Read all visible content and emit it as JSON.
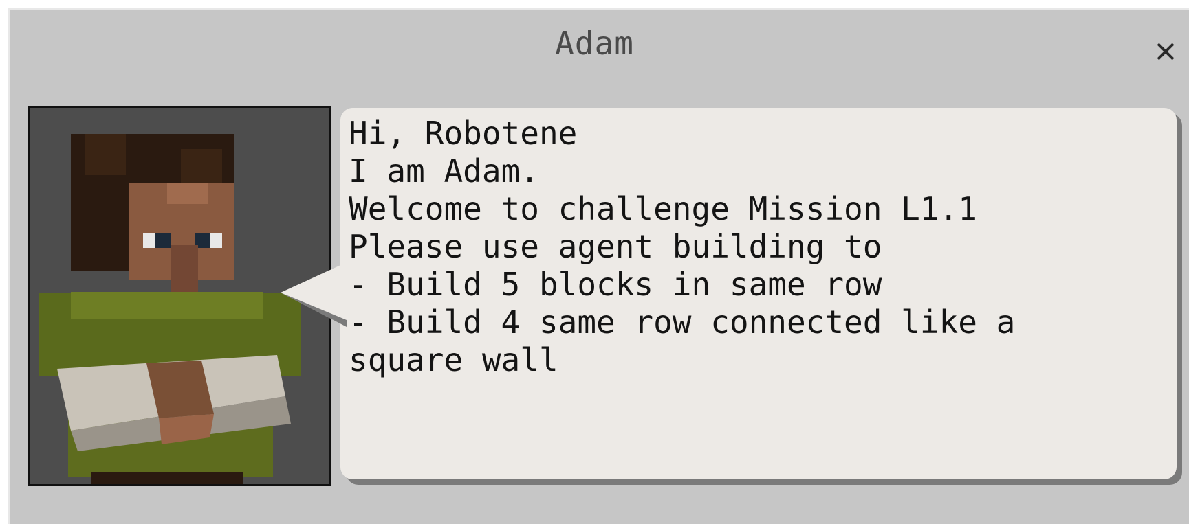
{
  "dialog": {
    "title": "Adam",
    "close_label": "×",
    "npc_portrait_icon": "villager-portrait-icon",
    "speech_lines": [
      "Hi, Robotene",
      "I am Adam.",
      "Welcome to challenge Mission L1.1",
      "Please use agent building to",
      "- Build 5 blocks in same row",
      "- Build 4 same row connected like a",
      "square wall"
    ]
  },
  "colors": {
    "panel": "#c6c6c6",
    "portrait_bg": "#4d4d4d",
    "speech_bg": "#edeae6",
    "text": "#141414"
  }
}
